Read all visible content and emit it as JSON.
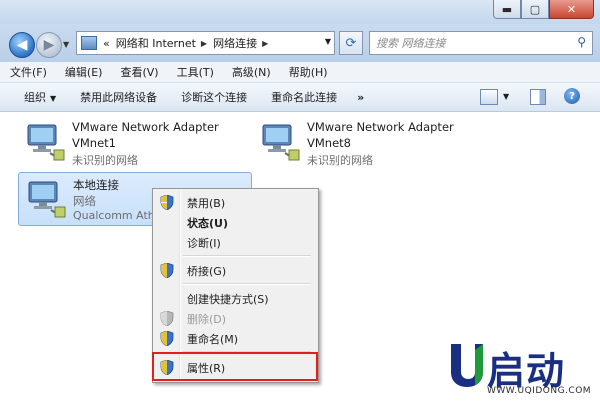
{
  "window": {
    "buttons": {
      "minimize": "▬",
      "maximize": "▢",
      "close": "✕"
    }
  },
  "nav": {
    "back_icon": "◀",
    "forward_icon": "▶",
    "address_prefix": "«",
    "breadcrumb": [
      "网络和 Internet",
      "网络连接"
    ],
    "refresh_icon": "⟳",
    "search_placeholder": "搜索 网络连接"
  },
  "menu": {
    "items": [
      "文件(F)",
      "编辑(E)",
      "查看(V)",
      "工具(T)",
      "高级(N)",
      "帮助(H)"
    ]
  },
  "commands": {
    "items": [
      "组织",
      "禁用此网络设备",
      "诊断这个连接",
      "重命名此连接"
    ],
    "more": "»",
    "help": "?"
  },
  "adapters": [
    {
      "name": "VMware Network Adapter",
      "sub": "VMnet1",
      "status": "未识别的网络"
    },
    {
      "name": "VMware Network Adapter",
      "sub": "VMnet8",
      "status": "未识别的网络"
    },
    {
      "name": "本地连接",
      "sub": "网络",
      "status": "Qualcomm Ath"
    }
  ],
  "context_menu": {
    "items": [
      {
        "label": "禁用(B)",
        "shield": true
      },
      {
        "label": "状态(U)",
        "bold": true
      },
      {
        "label": "诊断(I)"
      },
      {
        "label": "桥接(G)",
        "shield": true
      },
      {
        "label": "创建快捷方式(S)"
      },
      {
        "label": "删除(D)",
        "shield": true,
        "disabled": true
      },
      {
        "label": "重命名(M)",
        "shield": true
      },
      {
        "label": "属性(R)",
        "shield": true,
        "highlighted": true
      }
    ]
  },
  "logo": {
    "text": "U启动",
    "url": "WWW.UQIDONG.COM"
  },
  "colors": {
    "highlight_box": "#e0201e",
    "logo_blue": "#1b2f80",
    "logo_green": "#1f9a3a"
  }
}
